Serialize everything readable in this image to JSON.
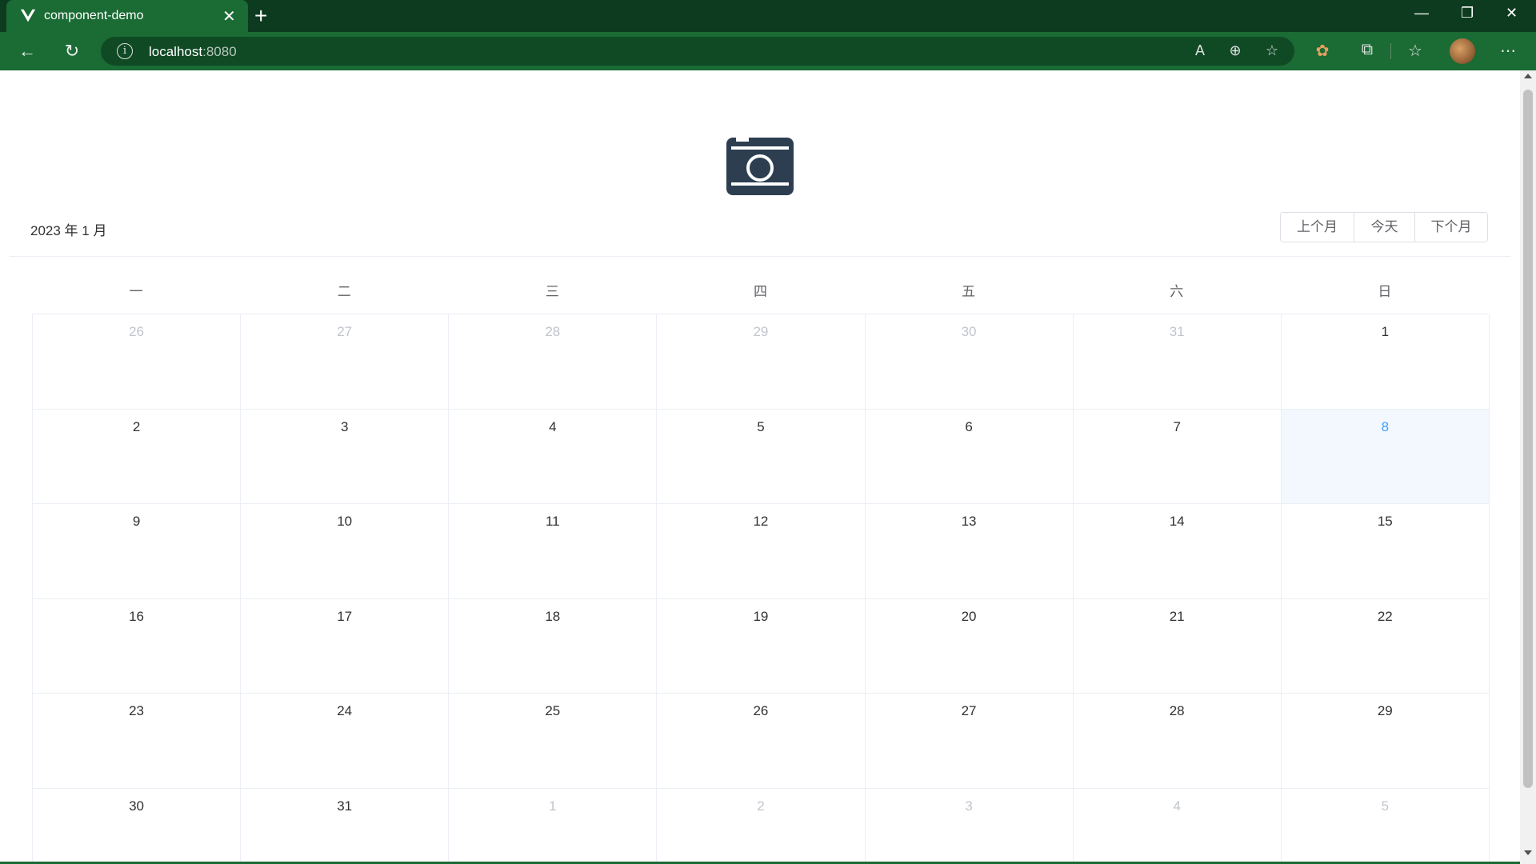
{
  "browser": {
    "tab_title": "component-demo",
    "url_host": "localhost",
    "url_port": ":8080"
  },
  "calendar": {
    "title": "2023 年 1 月",
    "buttons": {
      "prev": "上个月",
      "today": "今天",
      "next": "下个月"
    },
    "weekdays": [
      "一",
      "二",
      "三",
      "四",
      "五",
      "六",
      "日"
    ],
    "weeks": [
      [
        {
          "d": "26",
          "t": "prev"
        },
        {
          "d": "27",
          "t": "prev"
        },
        {
          "d": "28",
          "t": "prev"
        },
        {
          "d": "29",
          "t": "prev"
        },
        {
          "d": "30",
          "t": "prev"
        },
        {
          "d": "31",
          "t": "prev"
        },
        {
          "d": "1",
          "t": "current"
        }
      ],
      [
        {
          "d": "2",
          "t": "current"
        },
        {
          "d": "3",
          "t": "current"
        },
        {
          "d": "4",
          "t": "current"
        },
        {
          "d": "5",
          "t": "current"
        },
        {
          "d": "6",
          "t": "current"
        },
        {
          "d": "7",
          "t": "current"
        },
        {
          "d": "8",
          "t": "today"
        }
      ],
      [
        {
          "d": "9",
          "t": "current"
        },
        {
          "d": "10",
          "t": "current"
        },
        {
          "d": "11",
          "t": "current"
        },
        {
          "d": "12",
          "t": "current"
        },
        {
          "d": "13",
          "t": "current"
        },
        {
          "d": "14",
          "t": "current"
        },
        {
          "d": "15",
          "t": "current"
        }
      ],
      [
        {
          "d": "16",
          "t": "current"
        },
        {
          "d": "17",
          "t": "current"
        },
        {
          "d": "18",
          "t": "current"
        },
        {
          "d": "19",
          "t": "current"
        },
        {
          "d": "20",
          "t": "current"
        },
        {
          "d": "21",
          "t": "current"
        },
        {
          "d": "22",
          "t": "current"
        }
      ],
      [
        {
          "d": "23",
          "t": "current"
        },
        {
          "d": "24",
          "t": "current"
        },
        {
          "d": "25",
          "t": "current"
        },
        {
          "d": "26",
          "t": "current"
        },
        {
          "d": "27",
          "t": "current"
        },
        {
          "d": "28",
          "t": "current"
        },
        {
          "d": "29",
          "t": "current"
        }
      ],
      [
        {
          "d": "30",
          "t": "current"
        },
        {
          "d": "31",
          "t": "current"
        },
        {
          "d": "1",
          "t": "next"
        },
        {
          "d": "2",
          "t": "next"
        },
        {
          "d": "3",
          "t": "next"
        },
        {
          "d": "4",
          "t": "next"
        },
        {
          "d": "5",
          "t": "next"
        }
      ]
    ]
  },
  "colors": {
    "accent": "#409eff",
    "today_bg": "#f2f8fe",
    "chrome": "#1a6b34",
    "logo": "#2c3e50"
  },
  "icons": {
    "tab_logo": "vue-logo-icon",
    "page_logo": "camera-icon"
  }
}
